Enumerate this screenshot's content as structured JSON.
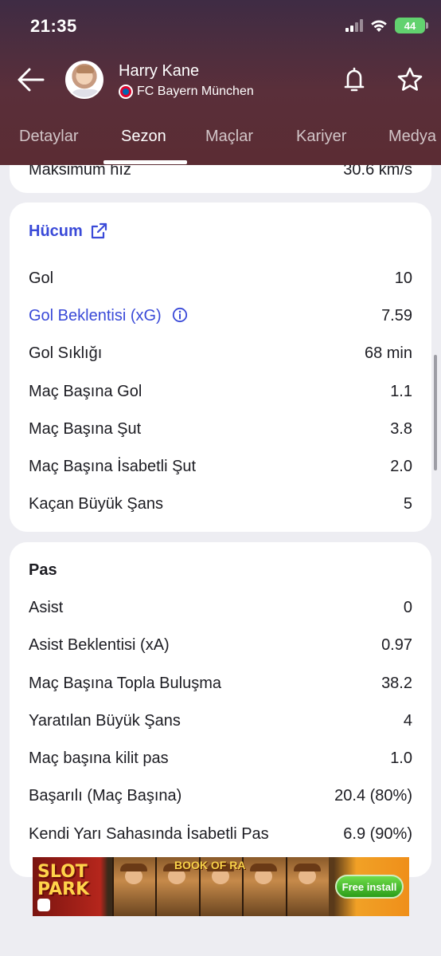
{
  "status_bar": {
    "time": "21:35",
    "battery": "44"
  },
  "header": {
    "player_name": "Harry Kane",
    "club_name": "FC Bayern München",
    "tabs": [
      {
        "label": "Detaylar"
      },
      {
        "label": "Sezon"
      },
      {
        "label": "Maçlar"
      },
      {
        "label": "Kariyer"
      },
      {
        "label": "Medya"
      }
    ],
    "active_tab": "Sezon"
  },
  "top_card": {
    "label": "Maksimum hız",
    "value": "30.6 km/s"
  },
  "attack": {
    "title": "Hücum",
    "rows": [
      {
        "label": "Gol",
        "value": "10"
      },
      {
        "label": "Gol Beklentisi (xG)",
        "value": "7.59"
      },
      {
        "label": "Gol Sıklığı",
        "value": "68 min"
      },
      {
        "label": "Maç Başına Gol",
        "value": "1.1"
      },
      {
        "label": "Maç Başına Şut",
        "value": "3.8"
      },
      {
        "label": "Maç Başına İsabetli Şut",
        "value": "2.0"
      },
      {
        "label": "Kaçan Büyük Şans",
        "value": "5"
      }
    ]
  },
  "passing": {
    "title": "Pas",
    "rows": [
      {
        "label": "Asist",
        "value": "0"
      },
      {
        "label": "Asist Beklentisi (xA)",
        "value": "0.97"
      },
      {
        "label": "Maç Başına Topla Buluşma",
        "value": "38.2"
      },
      {
        "label": "Yaratılan Büyük Şans",
        "value": "4"
      },
      {
        "label": "Maç başına kilit pas",
        "value": "1.0"
      },
      {
        "label": "Başarılı (Maç Başına)",
        "value": "20.4 (80%)"
      },
      {
        "label": "Kendi Yarı Sahasında İsabetli Pas",
        "value": "6.9 (90%)"
      }
    ]
  },
  "ad": {
    "brand": "SLOT PARK",
    "game": "BOOK OF RA",
    "cta": "Free install"
  },
  "colors": {
    "accent_link": "#3a4ad8",
    "header_bg": "#5a2f3a",
    "page_bg": "#ededf2"
  }
}
